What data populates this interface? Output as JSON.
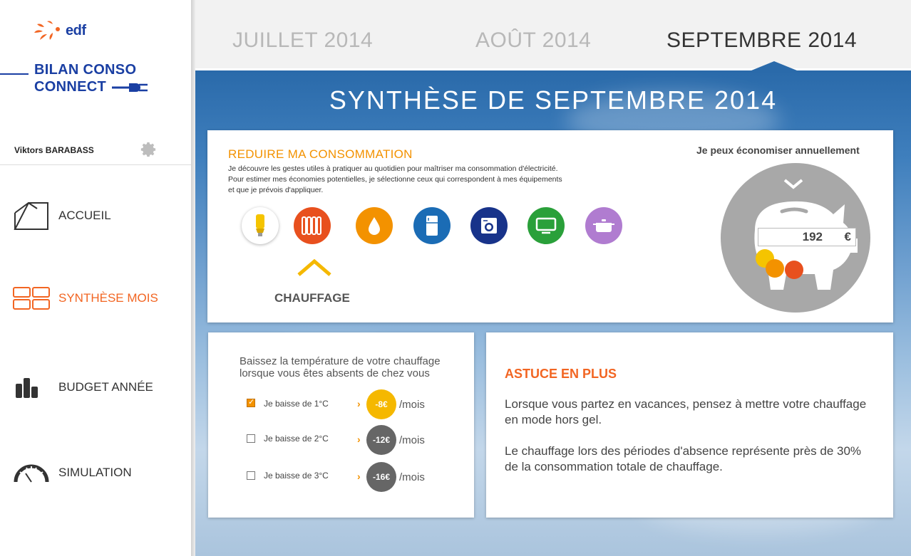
{
  "sidebar": {
    "logo_text": "edf",
    "brand_line1": "BILAN CONSO",
    "brand_line2": "CONNECT",
    "user_name": "Viktors BARABASS",
    "nav": [
      {
        "label": "ACCUEIL",
        "icon": "house-icon",
        "active": false
      },
      {
        "label": "SYNTHÈSE MOIS",
        "icon": "grid-icon",
        "active": true
      },
      {
        "label": "BUDGET ANNÉE",
        "icon": "bar-chart-icon",
        "active": false
      },
      {
        "label": "SIMULATION",
        "icon": "gauge-icon",
        "active": false
      }
    ]
  },
  "months": {
    "prev2": "JUILLET 2014",
    "prev1": "AOÛT 2014",
    "current": "SEPTEMBRE 2014"
  },
  "title": "SYNTHÈSE DE SEPTEMBRE  2014",
  "reduce": {
    "title": "REDUIRE MA CONSOMMATION",
    "desc_line1": "Je découvre les gestes utiles à pratiquer au quotidien pour maîtriser ma consommation d'électricité.",
    "desc_line2": "Pour estimer mes économies potentielles, je sélectionne ceux qui correspondent à mes équipements",
    "desc_line3": "et que je prévois d'appliquer.",
    "equipments": [
      {
        "icon": "lightbulb-icon",
        "color": "#ffffff"
      },
      {
        "icon": "radiator-icon",
        "color": "#e8501e"
      },
      {
        "icon": "water-drop-icon",
        "color": "#f39200"
      },
      {
        "icon": "fridge-icon",
        "color": "#1b6cb5"
      },
      {
        "icon": "washing-machine-icon",
        "color": "#18338a"
      },
      {
        "icon": "tv-icon",
        "color": "#2aa03a"
      },
      {
        "icon": "pot-icon",
        "color": "#b07cd0"
      }
    ],
    "selected_label": "CHAUFFAGE"
  },
  "savings": {
    "title": "Je peux économiser annuellement",
    "amount": "192",
    "currency": "€"
  },
  "temperature": {
    "title_line1": "Baissez la température de votre chauffage",
    "title_line2": "lorsque vous êtes absents de chez vous",
    "options": [
      {
        "label": "Je baisse de 1°C",
        "value": "-8€",
        "unit": "/mois",
        "checked": true,
        "color": "#f5b800"
      },
      {
        "label": "Je baisse de 2°C",
        "value": "-12€",
        "unit": "/mois",
        "checked": false,
        "color": "#666666"
      },
      {
        "label": "Je baisse de 3°C",
        "value": "-16€",
        "unit": "/mois",
        "checked": false,
        "color": "#666666"
      }
    ]
  },
  "tip": {
    "title": "ASTUCE EN PLUS",
    "p1": "Lorsque vous partez en vacances, pensez à mettre votre chauffage en mode hors gel.",
    "p2": "Le chauffage lors des périodes d'absence représente près de 30% de la consommation totale de chauffage."
  },
  "colors": {
    "brand_blue": "#1a3fa3",
    "accent_orange": "#f26522",
    "accent_yellow": "#f39200"
  }
}
